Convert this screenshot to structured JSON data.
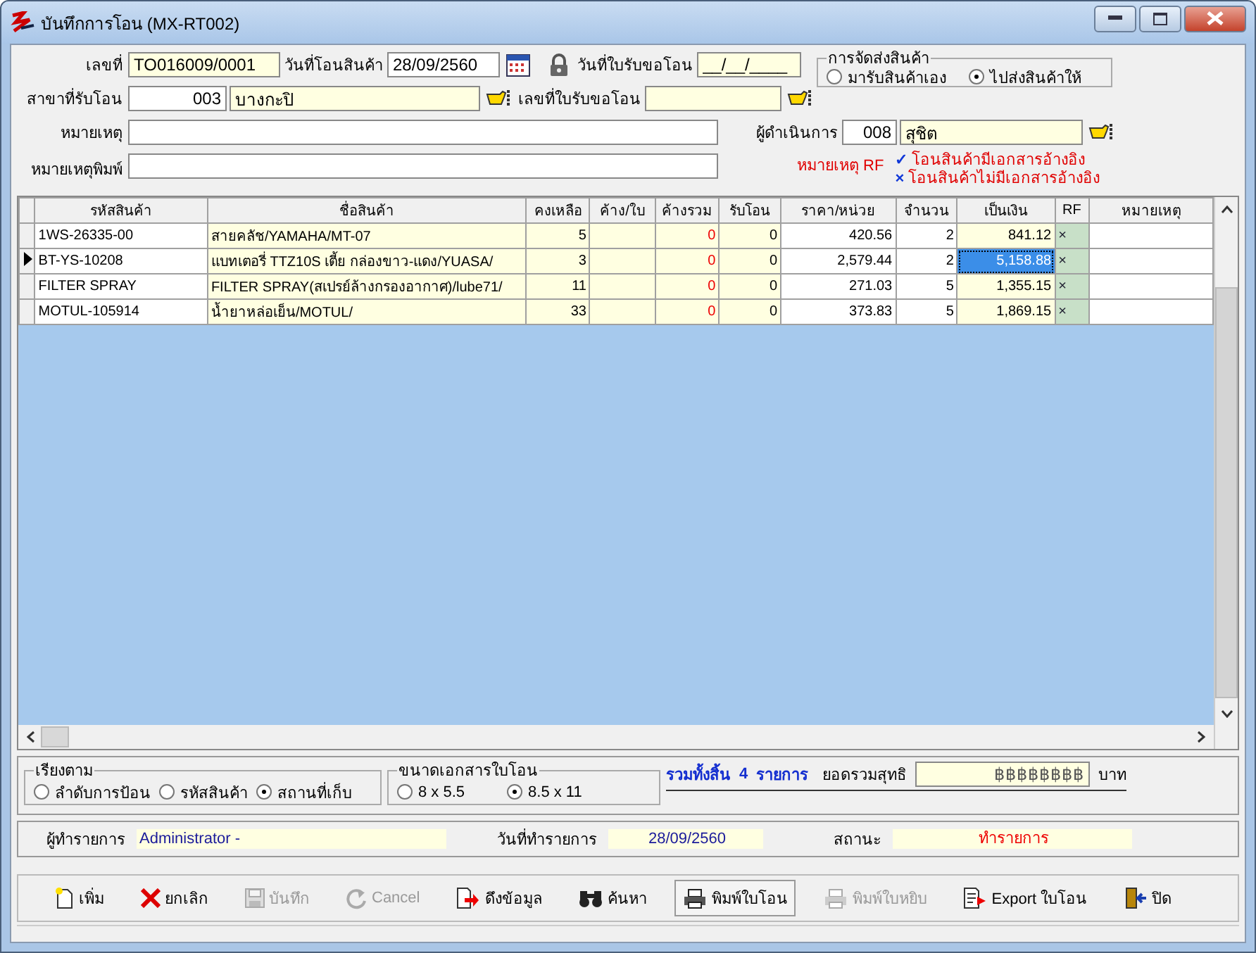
{
  "window": {
    "title": "บันทึกการโอน (MX-RT002)"
  },
  "header": {
    "doc_no": {
      "label": "เลขที่",
      "value": "TO016009/0001"
    },
    "transfer_date": {
      "label": "วันที่โอนสินค้า",
      "value": "28/09/2560"
    },
    "request_date": {
      "label": "วันที่ใบรับขอโอน",
      "value": "__/__/____"
    },
    "branch": {
      "label": "สาขาที่รับโอน",
      "code": "003",
      "name": "บางกะปิ"
    },
    "request_no": {
      "label": "เลขที่ใบรับขอโอน"
    },
    "note": {
      "label": "หมายเหตุ"
    },
    "print_note": {
      "label": "หมายเหตุพิมพ์"
    },
    "operator": {
      "label": "ผู้ดำเนินการ",
      "code": "008",
      "name": "สุชิต"
    },
    "delivery": {
      "title": "การจัดส่งสินค้า",
      "options": [
        {
          "label": "มารับสินค้าเอง",
          "selected": false
        },
        {
          "label": "ไปส่งสินค้าให้",
          "selected": true
        }
      ]
    },
    "rf_legend": {
      "label": "หมายเหตุ RF",
      "items": [
        {
          "symbol": "✓",
          "text": "โอนสินค้ามีเอกสารอ้างอิง"
        },
        {
          "symbol": "×",
          "text": "โอนสินค้าไม่มีเอกสารอ้างอิง"
        }
      ]
    }
  },
  "table": {
    "columns": [
      "รหัสสินค้า",
      "ชื่อสินค้า",
      "คงเหลือ",
      "ค้าง/ใบ",
      "ค้างรวม",
      "รับโอน",
      "ราคา/หน่วย",
      "จำนวน",
      "เป็นเงิน",
      "RF",
      "หมายเหตุ"
    ],
    "rows": [
      {
        "selected": false,
        "cells": [
          "1WS-26335-00",
          "สายคลัช/YAMAHA/MT-07",
          "5",
          "",
          "0",
          "0",
          "420.56",
          "2",
          "841.12",
          "×",
          ""
        ]
      },
      {
        "selected": true,
        "cells": [
          "BT-YS-10208",
          "แบทเตอรี่ TTZ10S เตี้ย กล่องขาว-แดง/YUASA/",
          "3",
          "",
          "0",
          "0",
          "2,579.44",
          "2",
          "5,158.88",
          "×",
          ""
        ]
      },
      {
        "selected": false,
        "cells": [
          "FILTER SPRAY",
          "FILTER SPRAY(สเปรย์ล้างกรองอากาศ)/lube71/",
          "11",
          "",
          "0",
          "0",
          "271.03",
          "5",
          "1,355.15",
          "×",
          ""
        ]
      },
      {
        "selected": false,
        "cells": [
          "MOTUL-105914",
          "น้ำยาหล่อเย็น/MOTUL/",
          "33",
          "",
          "0",
          "0",
          "373.83",
          "5",
          "1,869.15",
          "×",
          ""
        ]
      }
    ]
  },
  "sort": {
    "title": "เรียงตาม",
    "options": [
      {
        "label": "ลำดับการป้อน",
        "selected": false
      },
      {
        "label": "รหัสสินค้า",
        "selected": false
      },
      {
        "label": "สถานที่เก็บ",
        "selected": true
      }
    ]
  },
  "paper_size": {
    "title": "ขนาดเอกสารใบโอน",
    "options": [
      {
        "label": "8 x 5.5",
        "selected": false
      },
      {
        "label": "8.5 x 11",
        "selected": true
      }
    ]
  },
  "summary": {
    "total_label": "รวมทั้งสิ้น",
    "count": "4",
    "unit": "รายการ",
    "net_label": "ยอดรวมสุทธิ",
    "net_value": "฿฿฿฿฿฿฿฿",
    "currency": "บาท"
  },
  "info": {
    "user_label": "ผู้ทำรายการ",
    "user": "Administrator -",
    "date_label": "วันที่ทำรายการ",
    "date": "28/09/2560",
    "status_label": "สถานะ",
    "status": "ทำรายการ"
  },
  "toolbar": [
    {
      "kind": "new",
      "label": "เพิ่ม",
      "disabled": false,
      "focused": false
    },
    {
      "kind": "cancel",
      "label": "ยกเลิก",
      "disabled": false,
      "focused": false
    },
    {
      "kind": "save",
      "label": "บันทึก",
      "disabled": true,
      "focused": false
    },
    {
      "kind": "undo",
      "label": "Cancel",
      "disabled": true,
      "focused": false
    },
    {
      "kind": "import",
      "label": "ดึงข้อมูล",
      "disabled": false,
      "focused": false
    },
    {
      "kind": "find",
      "label": "ค้นหา",
      "disabled": false,
      "focused": false
    },
    {
      "kind": "print",
      "label": "พิมพ์ใบโอน",
      "disabled": false,
      "focused": true
    },
    {
      "kind": "print",
      "label": "พิมพ์ใบหยิบ",
      "disabled": true,
      "focused": false
    },
    {
      "kind": "export",
      "label": "Export ใบโอน",
      "disabled": false,
      "focused": false
    },
    {
      "kind": "exit",
      "label": "ปิด",
      "disabled": false,
      "focused": false
    }
  ]
}
